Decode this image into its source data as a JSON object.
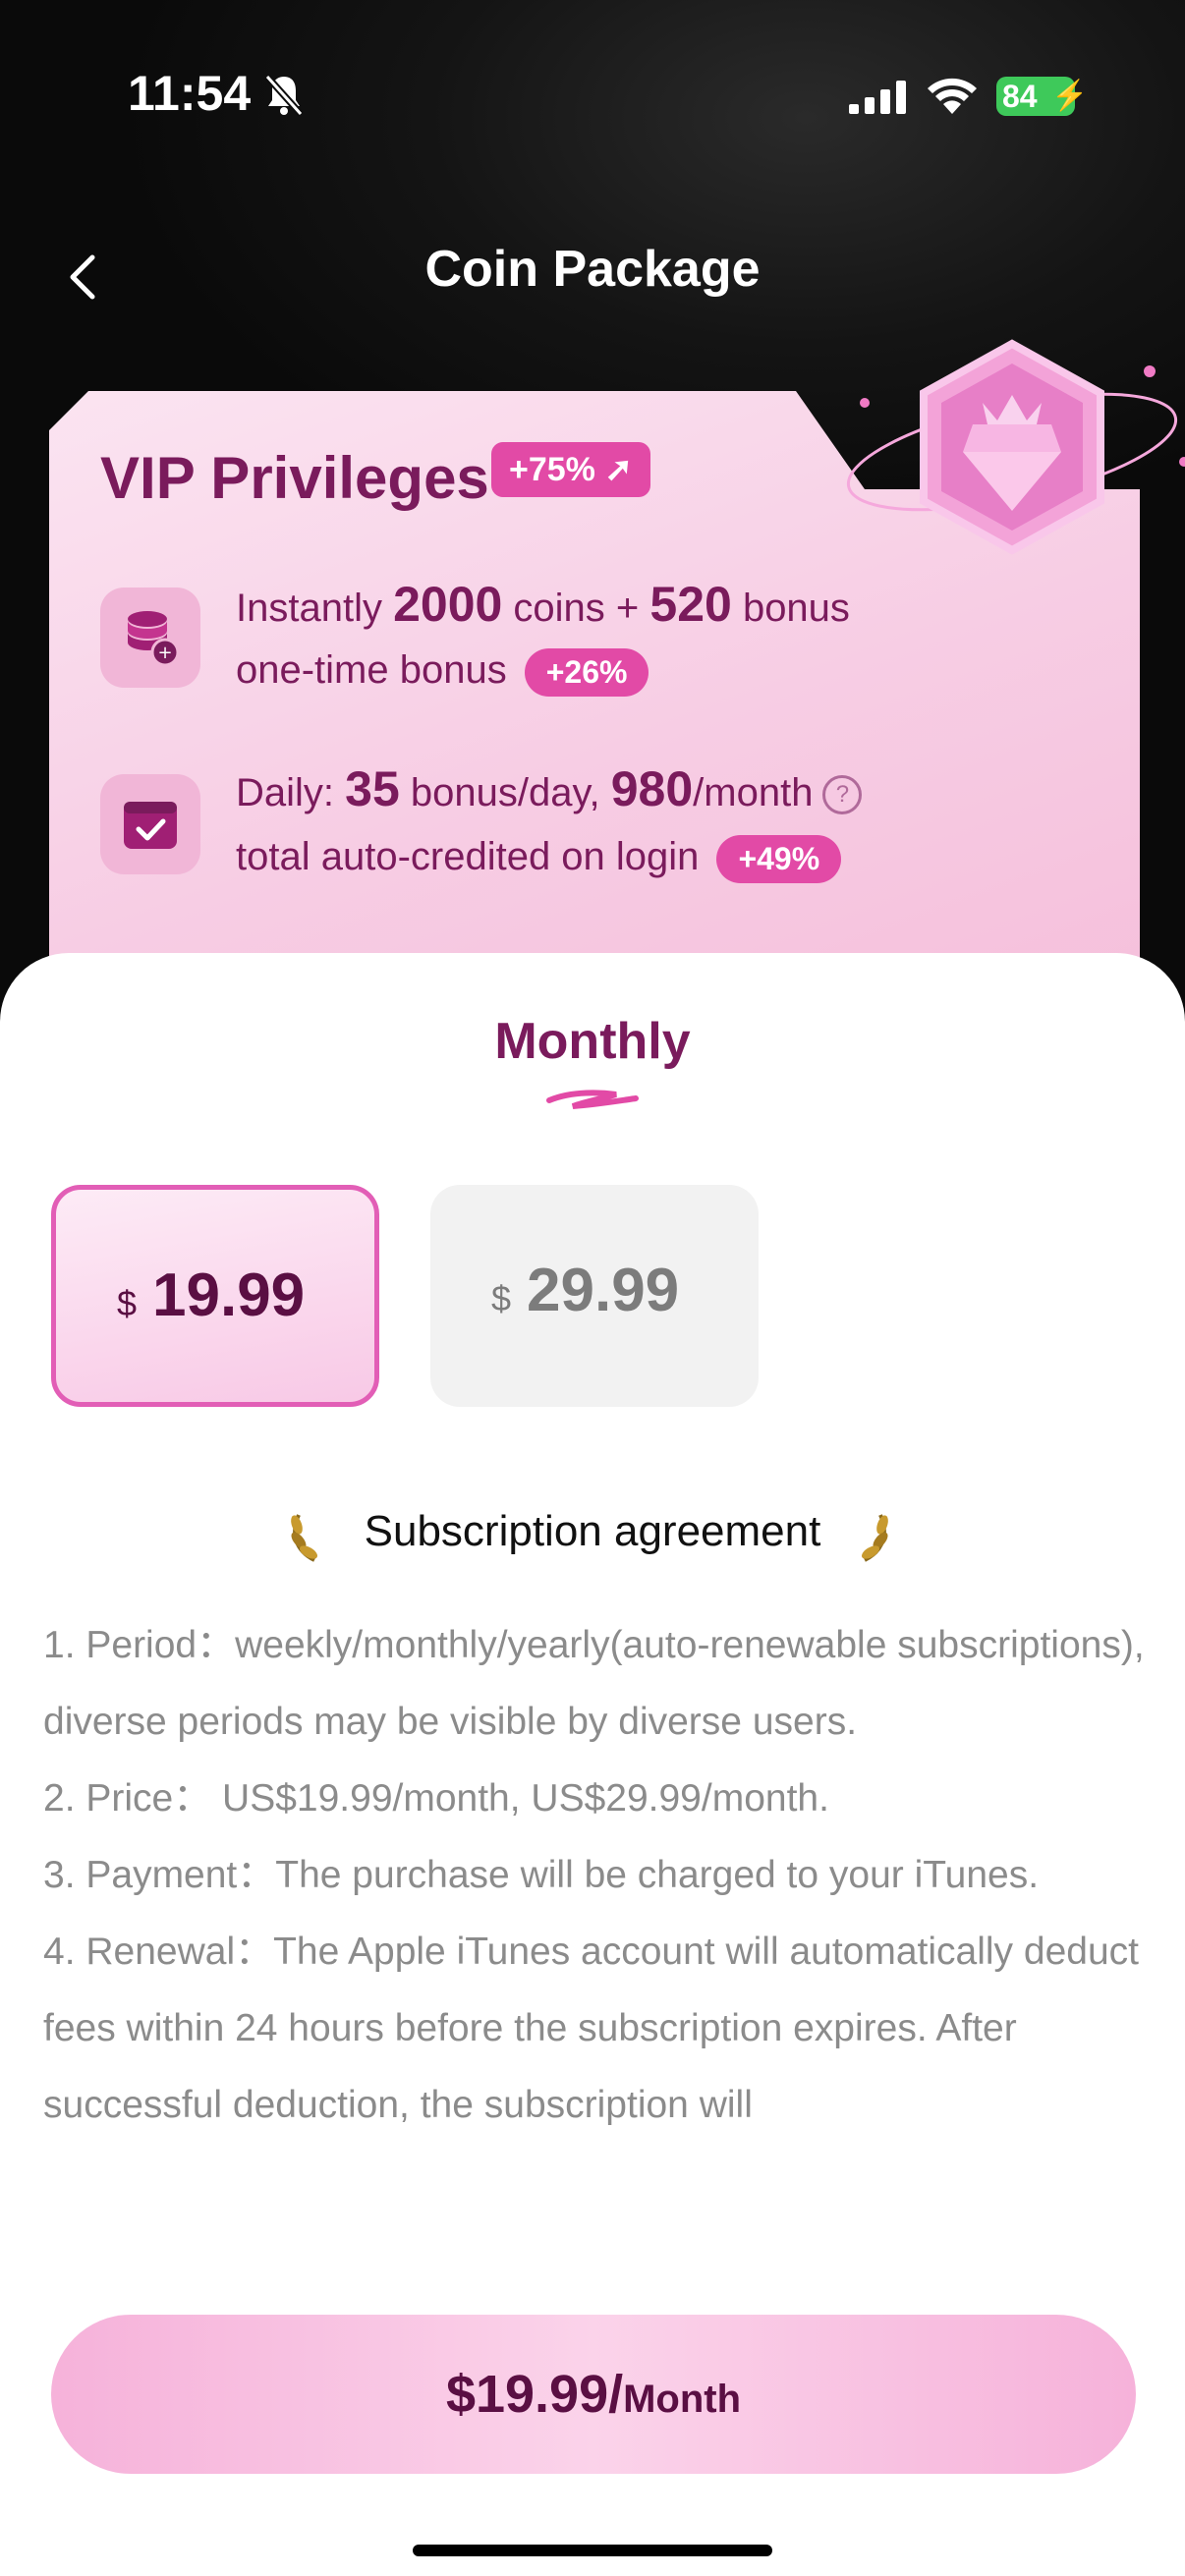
{
  "status_bar": {
    "time": "11:54",
    "battery": "84"
  },
  "header": {
    "title": "Coin Package"
  },
  "vip": {
    "title": "VIP Privileges",
    "badge": "+75%",
    "row1": {
      "pre": "Instantly ",
      "coins": "2000",
      "mid": " coins + ",
      "bonus": "520",
      "post": " bonus",
      "line2": "one-time bonus",
      "pill": "+26%"
    },
    "row2": {
      "pre": "Daily: ",
      "daily": "35",
      "mid": " bonus/day, ",
      "month": "980",
      "post": "/month",
      "line2": "total auto-credited on login",
      "pill": "+49%"
    }
  },
  "tabs": {
    "active": "Monthly"
  },
  "prices": [
    {
      "currency": "$",
      "amount": "19.99",
      "selected": true
    },
    {
      "currency": "$",
      "amount": "29.99",
      "selected": false
    }
  ],
  "agreement": {
    "title": "Subscription agreement",
    "lines": [
      "1. Period：weekly/monthly/yearly(auto-renewable subscriptions), diverse periods may be visible by diverse users.",
      "2. Price： US$19.99/month, US$29.99/month.",
      "3. Payment：The purchase will be charged to your iTunes.",
      "4. Renewal：The Apple iTunes account will automatically deduct fees within 24 hours before the subscription expires. After successful deduction, the subscription will"
    ]
  },
  "cta": {
    "price": "$19.99/",
    "period": "Month"
  }
}
